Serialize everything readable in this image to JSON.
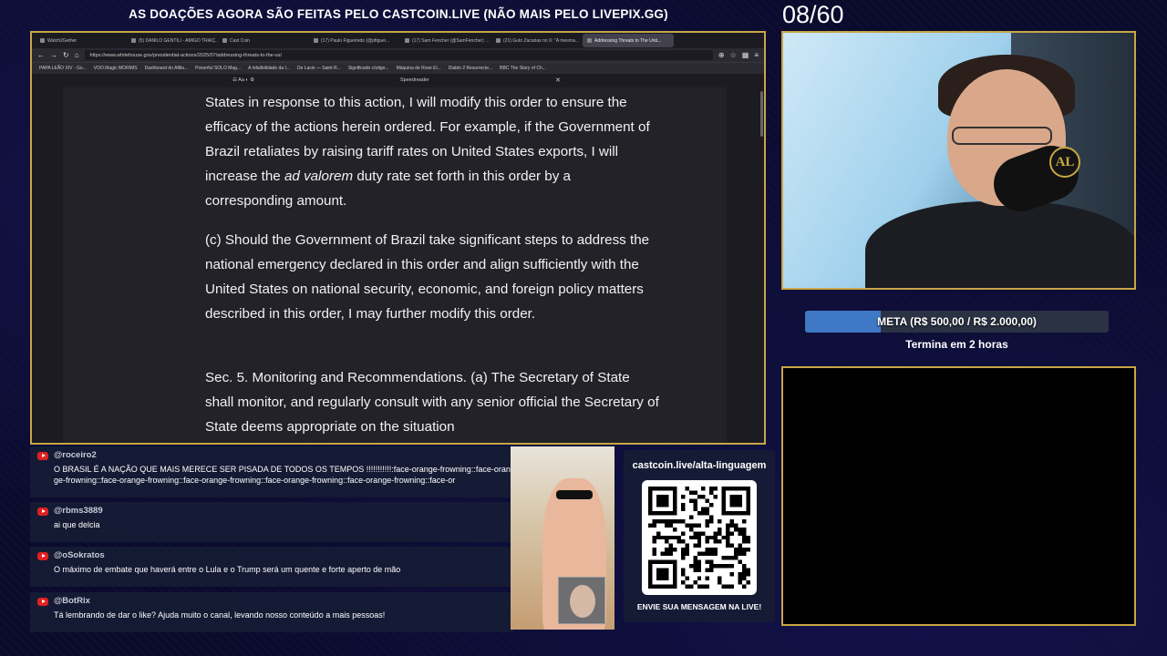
{
  "banner": "AS DOAÇÕES AGORA SÃO FEITAS PELO CASTCOIN.LIVE (NÃO MAIS PELO LIVEPIX.GG)",
  "counter": "08/60",
  "browser": {
    "tabs": [
      {
        "label": "Watch2Gether",
        "active": false
      },
      {
        "label": "(5) DANILO GENTILI - AMIGO TRAIÇ...",
        "active": false
      },
      {
        "label": "Cast Coin",
        "active": false
      },
      {
        "label": "(17) Paulo Figueiredo (@pfiguei...",
        "active": false
      },
      {
        "label": "(17) Sam Fencher (@SamFencher) ...",
        "active": false
      },
      {
        "label": "(21) Guto Zacarias no X: \"A mesma...",
        "active": false
      },
      {
        "label": "Addressing Threats to The Unit...",
        "active": true
      }
    ],
    "url": "https://www.whitehouse.gov/presidential-actions/2025/07/addressing-threats-to-the-us/",
    "bookmarks": [
      "PAPA LEÃO XIV - Go...",
      "VOO.Magic MORIMS",
      "Dashboard do Afilia...",
      "Powerful SOLO Mag...",
      "A infalibilidade da I...",
      "De Lacis — Saint R...",
      "Significado código...",
      "Máquina de Rose El...",
      "Diablo 2 Resurrecte...",
      "BBC The Story of Ch..."
    ],
    "reader_title": "Speedreader"
  },
  "document": {
    "para1_before": "States in response to this action, I will modify this order to ensure the efficacy of the actions herein ordered.  For example, if the Government of Brazil retaliates by raising tariff rates on United States exports, I will increase the ",
    "para1_em": "ad valorem",
    "para1_after": " duty rate set forth in this order by a corresponding amount.",
    "para2": "(c)  Should the Government of Brazil take significant steps to address the national emergency declared in this order and align sufficiently with the United States on national security, economic, and foreign policy matters described in this order, I may further modify this order.",
    "para3": "Sec. 5.  Monitoring and Recommendations.  (a)  The Secretary of State shall monitor, and regularly consult with any senior official the Secretary of State deems appropriate on the situation"
  },
  "webcam": {
    "logo_text": "AL"
  },
  "meta": {
    "label": "META (R$ 500,00 / R$ 2.000,00)",
    "progress": 0.25,
    "subtitle": "Termina em 2 horas"
  },
  "chat": [
    {
      "user": "@roceiro2",
      "text": "O BRASIL É A NAÇÃO QUE MAIS MERECE SER PISADA DE TODOS OS TEMPOS !!!!!!!!!!!:face-orange-frowning::face-orange-frowning::face-orange-frowning::face-orange-frowning::face-orange-frowning::face-orange-frowning::face-or"
    },
    {
      "user": "@rbms3889",
      "text": "ai que delcia"
    },
    {
      "user": "@oSokratos",
      "text": "O máximo de embate que haverá entre o Lula e o Trump será um quente e forte aperto de mão"
    },
    {
      "user": "@BotRix",
      "text": "Tá lembrando de dar o like? Ajuda muito o canal, levando nosso conteúdo a mais pessoas!"
    }
  ],
  "qr": {
    "url": "castcoin.live/alta-linguagem",
    "cta": "ENVIE SUA MENSAGEM NA LIVE!"
  },
  "colors": {
    "frame_gold": "#c8a646",
    "progress_blue": "#3f78c4",
    "youtube_red": "#e02020"
  }
}
